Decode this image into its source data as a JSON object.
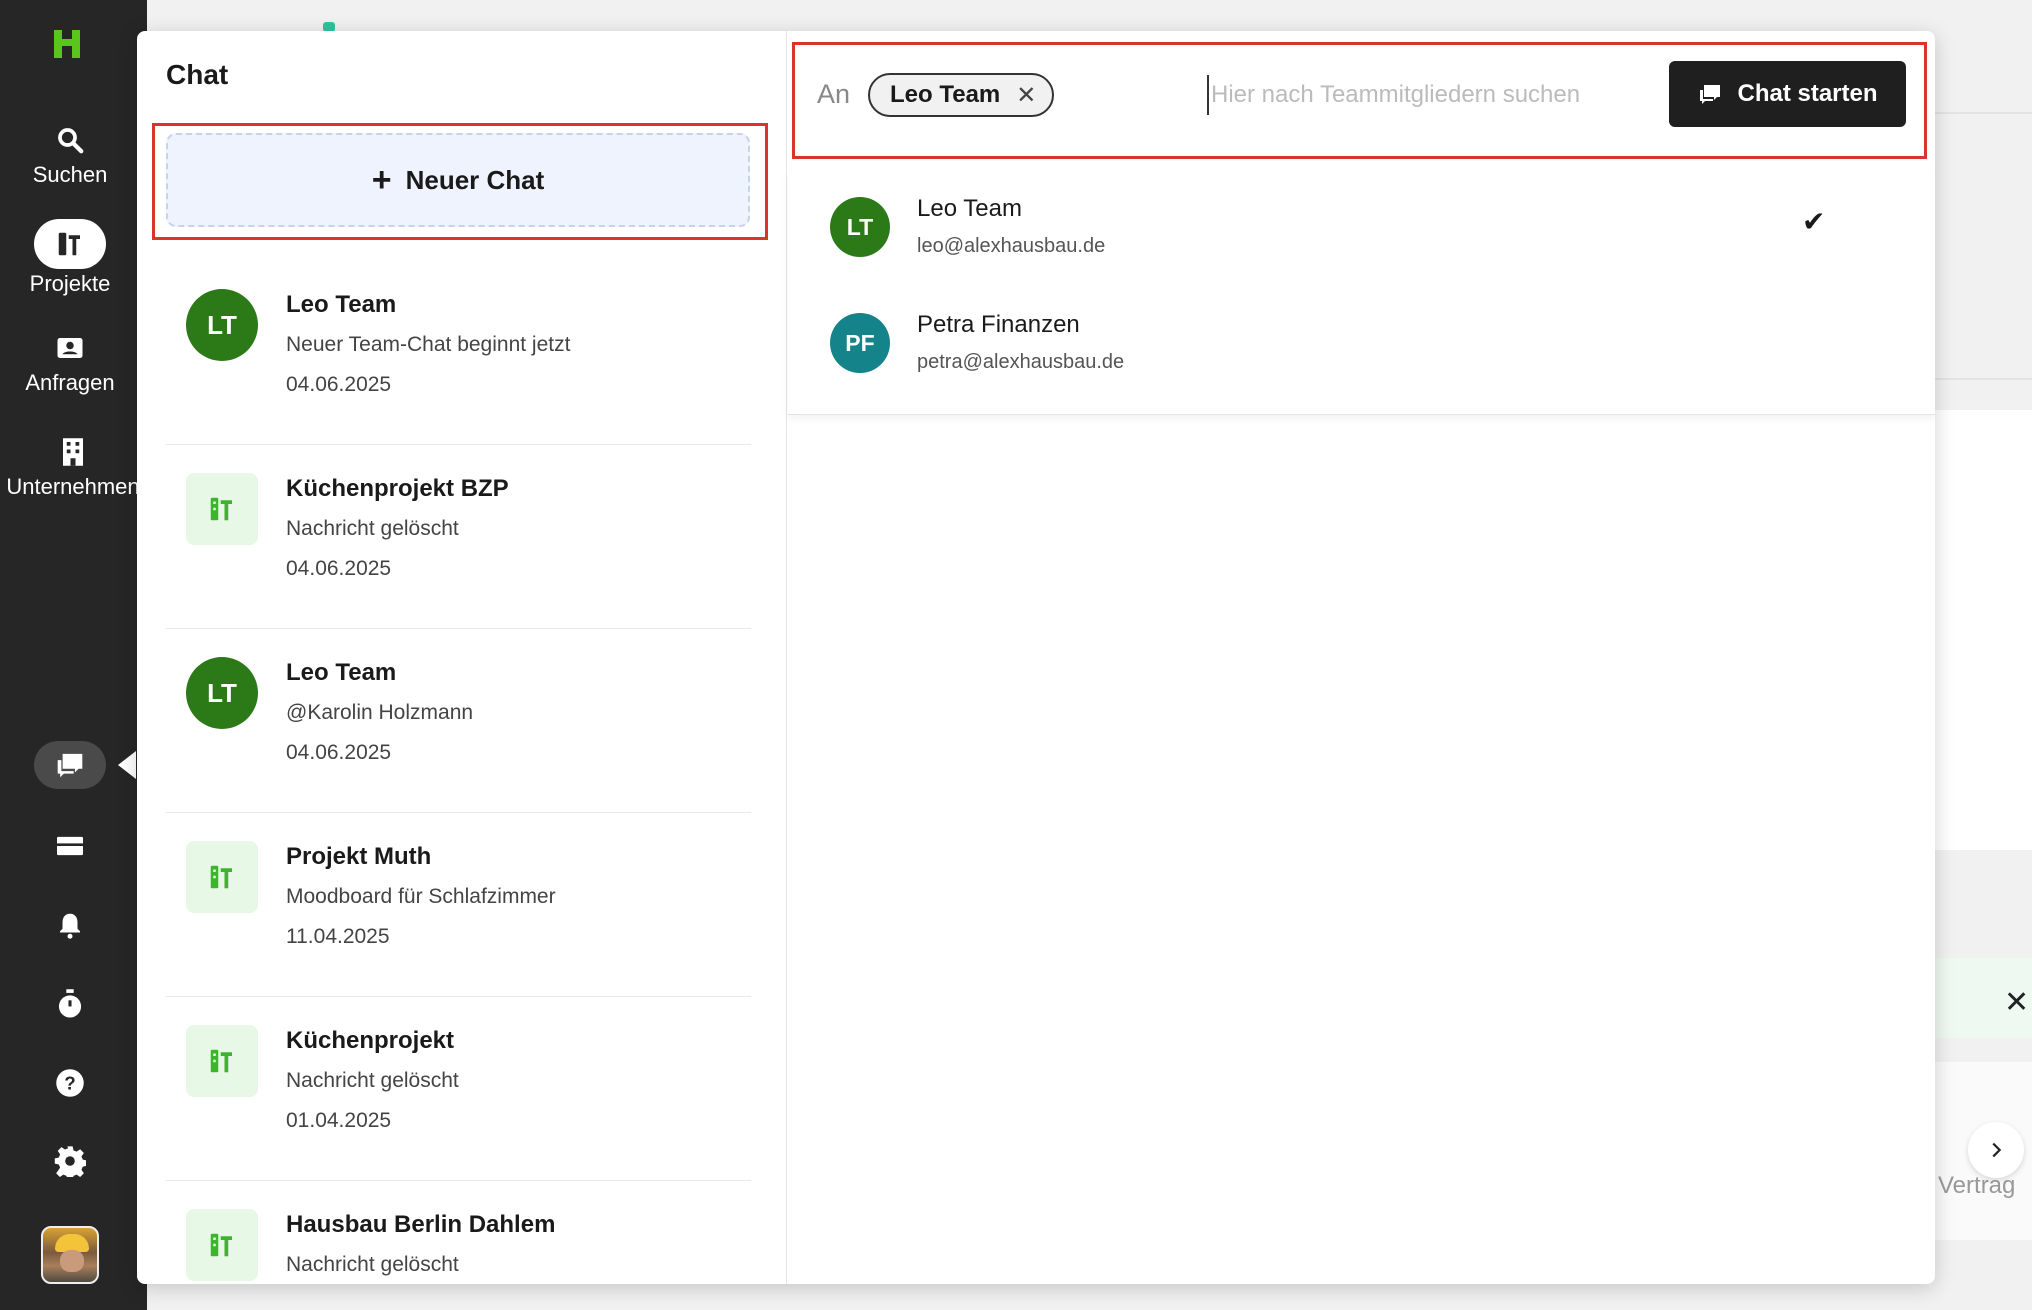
{
  "nav": {
    "items": [
      {
        "label": "Suchen",
        "icon": "search-icon"
      },
      {
        "label": "Projekte",
        "icon": "projects-icon"
      },
      {
        "label": "Anfragen",
        "icon": "requests-icon"
      },
      {
        "label": "Unternehmen",
        "icon": "company-icon"
      }
    ],
    "bottom_icons": [
      "chat-icon",
      "inbox-icon",
      "bell-icon",
      "timer-icon",
      "help-icon",
      "gear-icon"
    ],
    "brand_color": "#5cc51c"
  },
  "chat_panel": {
    "title": "Chat",
    "new_chat_label": "Neuer Chat",
    "items": [
      {
        "name": "Leo Team",
        "initials": "LT",
        "type": "person",
        "message": "Neuer Team-Chat beginnt jetzt",
        "date": "04.06.2025"
      },
      {
        "name": "Küchenprojekt BZP",
        "initials": "",
        "type": "project",
        "message": "Nachricht gelöscht",
        "date": "04.06.2025"
      },
      {
        "name": "Leo Team",
        "initials": "LT",
        "type": "person",
        "message": "@Karolin Holzmann",
        "date": "04.06.2025"
      },
      {
        "name": "Projekt Muth",
        "initials": "",
        "type": "project",
        "message": "Moodboard für Schlafzimmer",
        "date": "11.04.2025"
      },
      {
        "name": "Küchenprojekt",
        "initials": "",
        "type": "project",
        "message": "Nachricht gelöscht",
        "date": "01.04.2025"
      },
      {
        "name": "Hausbau Berlin Dahlem",
        "initials": "",
        "type": "project",
        "message": "Nachricht gelöscht",
        "date": ""
      }
    ]
  },
  "compose": {
    "to_label": "An",
    "selected_chip": "Leo Team",
    "search_placeholder": "Hier nach Teammitgliedern suchen",
    "search_value": "",
    "start_button": "Chat starten",
    "results": [
      {
        "initials": "LT",
        "name": "Leo Team",
        "email": "leo@alexhausbau.de",
        "selected": true
      },
      {
        "initials": "PF",
        "name": "Petra Finanzen",
        "email": "petra@alexhausbau.de",
        "selected": false
      }
    ]
  },
  "background": {
    "right_label": "Vertrag"
  }
}
